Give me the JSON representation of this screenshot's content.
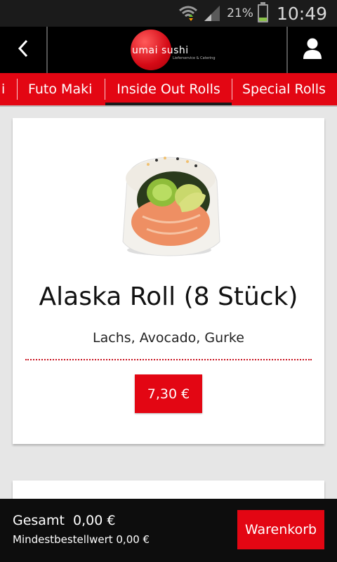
{
  "status_bar": {
    "battery_percent": "21%",
    "battery_level": 0.21,
    "time": "10:49"
  },
  "app_bar": {
    "logo_text_1": "umai",
    "logo_text_2": "sushi",
    "logo_subtext": "Lieferservice & Catering",
    "back_icon": "chevron-left-icon",
    "user_icon": "user-icon"
  },
  "tabs": [
    {
      "label": "i"
    },
    {
      "label": "Futo Maki"
    },
    {
      "label": "Inside Out Rolls",
      "active": true
    },
    {
      "label": "Special Rolls"
    }
  ],
  "product": {
    "name": "Alaska Roll (8 Stück)",
    "description": "Lachs, Avocado, Gurke",
    "price": "7,30 €"
  },
  "footer": {
    "total": "Gesamt  0,00 €",
    "min_order": "Mindestbestellwert 0,00 €",
    "cart_label": "Warenkorb"
  },
  "colors": {
    "brand_red": "#e30613",
    "app_bar": "#000000",
    "status_bar": "#1b1b1b",
    "background": "#e6e6e6"
  }
}
